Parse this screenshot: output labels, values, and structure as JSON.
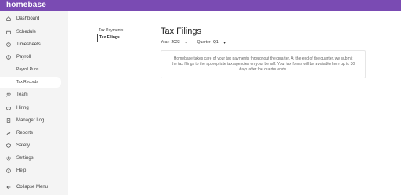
{
  "app": {
    "brand": "homebase"
  },
  "sidebar": {
    "items": [
      {
        "label": "Dashboard",
        "icon": "home-icon"
      },
      {
        "label": "Schedule",
        "icon": "calendar-icon"
      },
      {
        "label": "Timesheets",
        "icon": "clock-icon"
      },
      {
        "label": "Payroll",
        "icon": "dollar-icon"
      },
      {
        "label": "Payroll Runs"
      },
      {
        "label": "Tax Records"
      },
      {
        "label": "Team",
        "icon": "team-icon"
      },
      {
        "label": "Hiring",
        "icon": "hiring-icon"
      },
      {
        "label": "Manager Log",
        "icon": "book-icon"
      },
      {
        "label": "Reports",
        "icon": "chart-icon"
      },
      {
        "label": "Safety",
        "icon": "shield-icon"
      },
      {
        "label": "Settings",
        "icon": "gear-icon"
      },
      {
        "label": "Help",
        "icon": "help-icon"
      }
    ],
    "collapse_label": "Collapse Menu"
  },
  "subnav": {
    "items": [
      "Tax Payments",
      "Tax Filings"
    ]
  },
  "main": {
    "title": "Tax Filings",
    "year_label": "Year:",
    "year_value": "2023",
    "quarter_label": "Quarter:",
    "quarter_value": "Q1",
    "info": "Homebase takes care of your tax payments throughout the quarter. At the end of the quarter, we submit the tax filings to the appropriate tax agencies on your behalf. Your tax forms will be available here up to 30 days after the quarter ends."
  }
}
